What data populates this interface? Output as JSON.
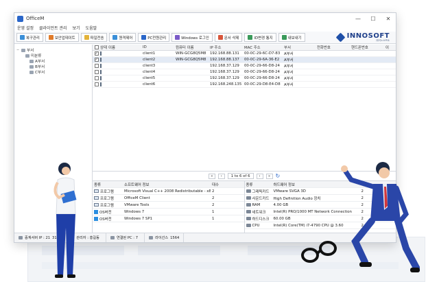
{
  "app": {
    "title": "OfficeM"
  },
  "window_controls": {
    "minimize": "—",
    "maximize": "☐",
    "close": "✕"
  },
  "menu": [
    "운영 설정",
    "클라이언트 관리",
    "보기",
    "도움말"
  ],
  "toolbar": [
    {
      "label": "복구관리",
      "icon": "restore-icon",
      "color": "#3a8fd8"
    },
    {
      "label": "보안업데이트",
      "icon": "update-icon",
      "color": "#e07b2a"
    },
    {
      "label": "파일전송",
      "icon": "file-transfer-icon",
      "color": "#e3b33a"
    },
    {
      "label": "원격제어",
      "icon": "remote-control-icon",
      "color": "#3a8fd8"
    },
    {
      "label": "PC전원관리",
      "icon": "power-icon",
      "color": "#2a66c9"
    },
    {
      "label": "Windows 로그인",
      "icon": "windows-login-icon",
      "color": "#7a5ac8"
    },
    {
      "label": "문서 삭제",
      "icon": "doc-delete-icon",
      "color": "#d8553a"
    },
    {
      "label": "ID변경 통지",
      "icon": "id-change-icon",
      "color": "#3a9a5a"
    },
    {
      "label": "내보내기",
      "icon": "export-icon",
      "color": "#3a9a5a"
    }
  ],
  "logo": {
    "brand": "INNOSOFT",
    "sub": "㈜이노소프트",
    "color": "#1e3f8a"
  },
  "tree": [
    {
      "label": "부서",
      "level": 0,
      "expander": "−"
    },
    {
      "label": "미분류",
      "level": 1,
      "expander": ""
    },
    {
      "label": "A부서",
      "level": 2,
      "expander": ""
    },
    {
      "label": "B부서",
      "level": 2,
      "expander": ""
    },
    {
      "label": "C부서",
      "level": 2,
      "expander": ""
    }
  ],
  "grid": {
    "headers": [
      "상태",
      "이름",
      "ID",
      "컴퓨터 이름",
      "IP 주소",
      "MAC 주소",
      "부서",
      "전화번호",
      "핸드폰번호",
      "이"
    ],
    "rows": [
      {
        "checked": true,
        "online": true,
        "name": "",
        "id": "client1",
        "pc": "WIN-GCG8Q5M8",
        "ip": "192.168.88.131",
        "mac": "00-0C-29-6C-D7-83",
        "dept": "A부서",
        "tel": "",
        "hp": "",
        "selected": false
      },
      {
        "checked": true,
        "online": true,
        "name": "",
        "id": "client2",
        "pc": "WIN-GCG8Q5M8",
        "ip": "192.168.88.137",
        "mac": "00-0C-29-6A-36-E2",
        "dept": "A부서",
        "tel": "",
        "hp": "",
        "selected": true
      },
      {
        "checked": false,
        "online": false,
        "name": "",
        "id": "client3",
        "pc": "",
        "ip": "192.168.37.129",
        "mac": "00-0C-29-66-D8-24",
        "dept": "A부서",
        "tel": "",
        "hp": "",
        "selected": false
      },
      {
        "checked": false,
        "online": false,
        "name": "",
        "id": "client4",
        "pc": "",
        "ip": "192.168.37.129",
        "mac": "00-0C-29-66-D8-24",
        "dept": "A부서",
        "tel": "",
        "hp": "",
        "selected": false
      },
      {
        "checked": false,
        "online": false,
        "name": "",
        "id": "client5",
        "pc": "",
        "ip": "192.168.37.129",
        "mac": "00-0C-29-66-D8-24",
        "dept": "A부서",
        "tel": "",
        "hp": "",
        "selected": false
      },
      {
        "checked": false,
        "online": false,
        "name": "",
        "id": "client6",
        "pc": "",
        "ip": "192.168.248.135",
        "mac": "00-0C-29-D8-E4-D8",
        "dept": "A부서",
        "tel": "",
        "hp": "",
        "selected": false
      }
    ]
  },
  "pager": {
    "first": "«",
    "prev": "‹",
    "text": "1 to 6 of 6",
    "next": "›",
    "last": "»",
    "refresh": "↻"
  },
  "software": {
    "headers": [
      "종류",
      "소프트웨어 정보",
      "대수"
    ],
    "rows": [
      {
        "kind": "프로그램",
        "info": "Microsoft Visual C++ 2008 Redistributable - x8",
        "count": "2",
        "win": false
      },
      {
        "kind": "프로그램",
        "info": "OfficeM Client",
        "count": "2",
        "win": false
      },
      {
        "kind": "프로그램",
        "info": "VMware Tools",
        "count": "2",
        "win": false
      },
      {
        "kind": "OS버전",
        "info": "Windows 7",
        "count": "1",
        "win": true
      },
      {
        "kind": "OS버전",
        "info": "Windows 7 SP1",
        "count": "1",
        "win": true
      }
    ]
  },
  "hardware": {
    "headers": [
      "종류",
      "하드웨어 정보",
      "대수"
    ],
    "rows": [
      {
        "kind": "그래픽카드",
        "info": "VMware SVGA 3D",
        "count": "2"
      },
      {
        "kind": "사운드카드",
        "info": "High Definition Audio 장치",
        "count": "2"
      },
      {
        "kind": "RAM",
        "info": "4.00 GB",
        "count": "2"
      },
      {
        "kind": "네트워크",
        "info": "Intel(R) PRO/1000 MT Network Connection",
        "count": "2"
      },
      {
        "kind": "하드디스크",
        "info": "60.00 GB",
        "count": "2"
      },
      {
        "kind": "CPU",
        "info": "Intel(R) Core(TM) i7-4790 CPU @ 3.60",
        "count": "2"
      }
    ]
  },
  "status": [
    {
      "label": "중계서버 IP : 21",
      "value": "3152"
    },
    {
      "label": "관리자 : 홍길동",
      "value": ""
    },
    {
      "label": "연결된 PC : 7",
      "value": ""
    },
    {
      "label": "라이선스",
      "value": "1564"
    }
  ]
}
